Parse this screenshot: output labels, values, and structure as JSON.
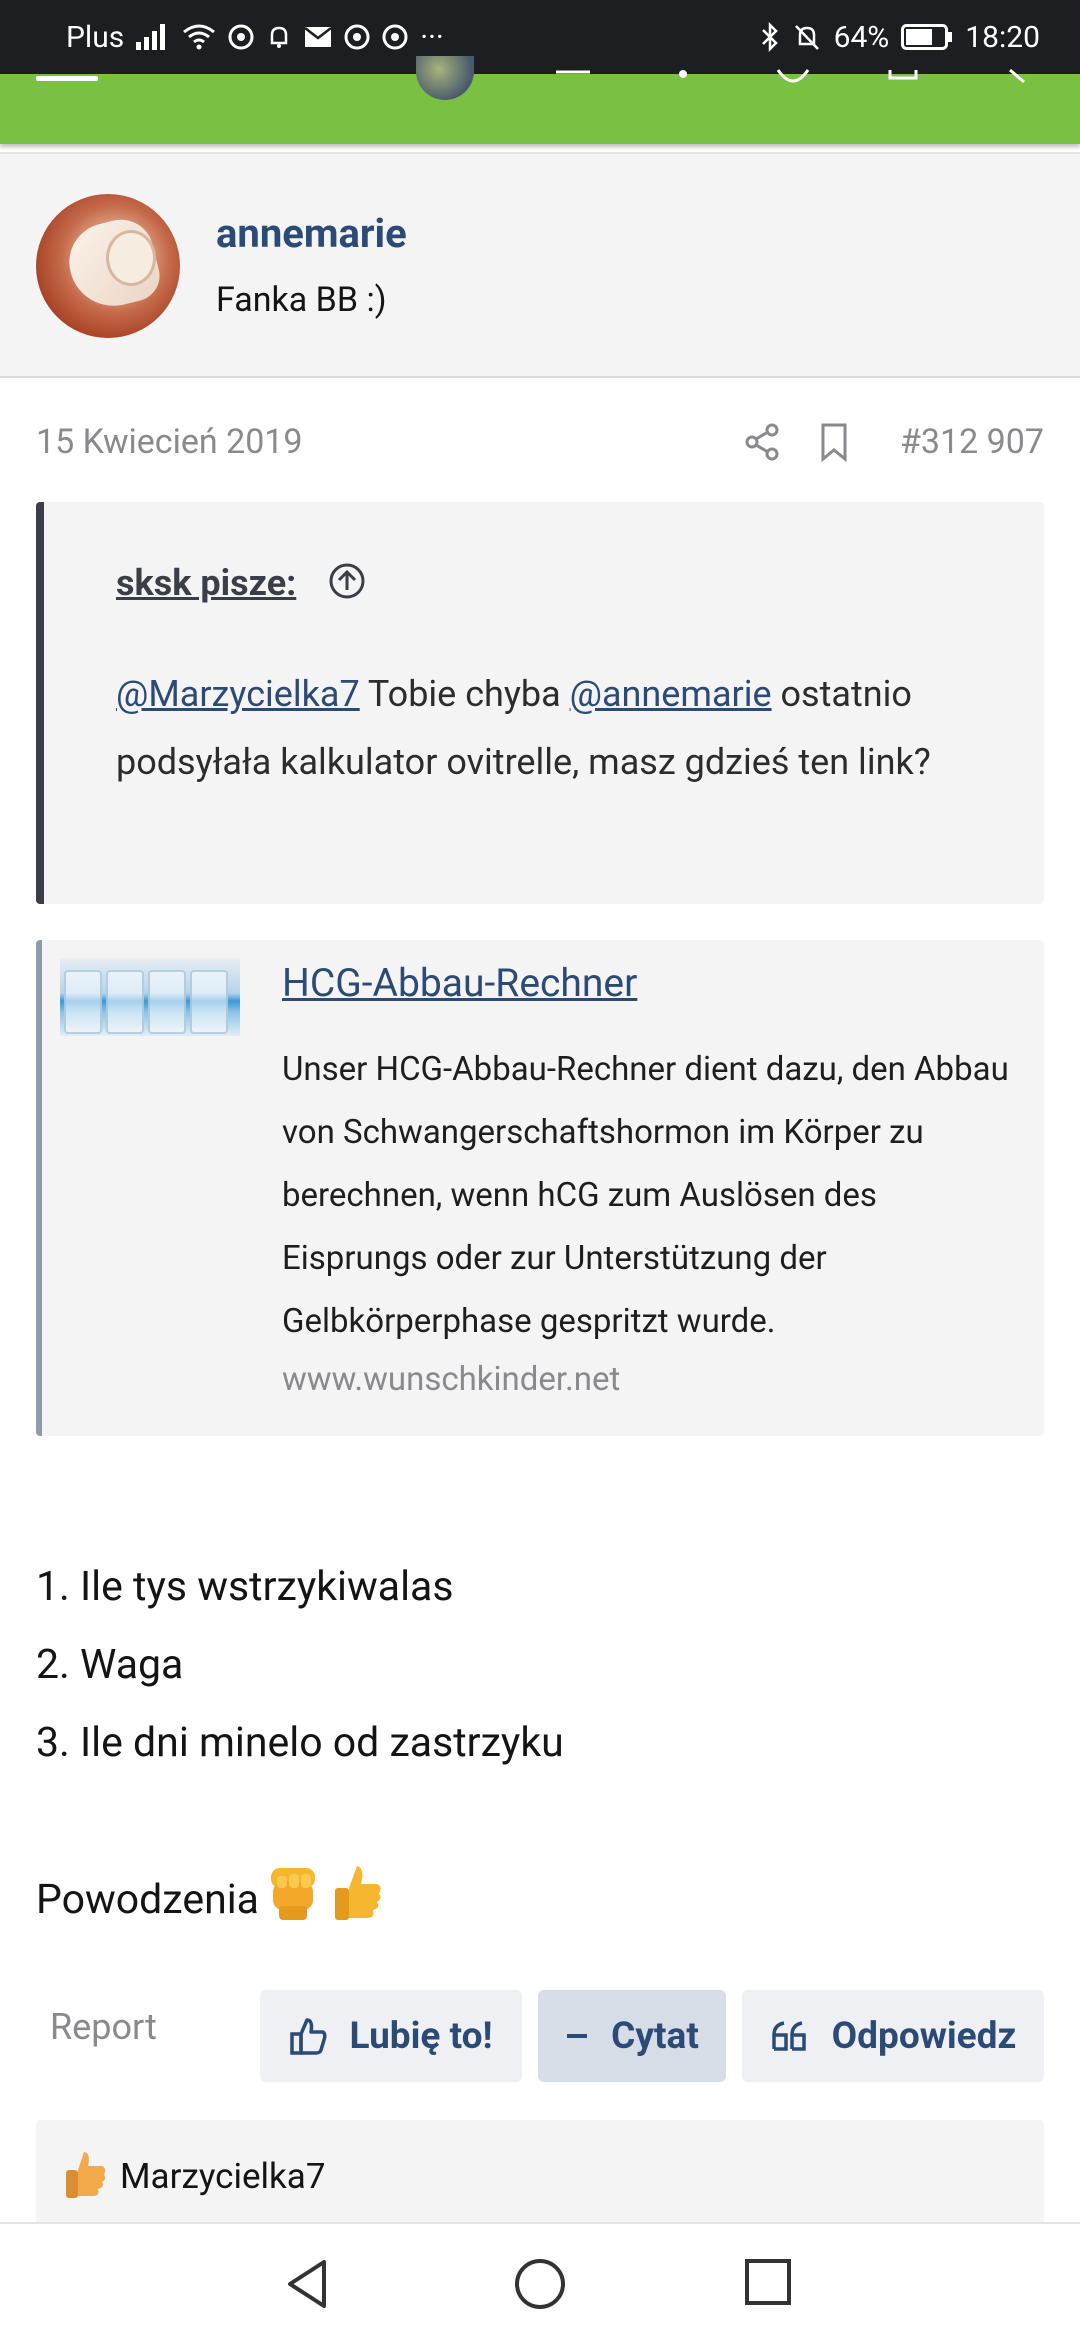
{
  "status_bar": {
    "carrier": "Plus",
    "battery": "64%",
    "time": "18:20",
    "more": "···"
  },
  "author": {
    "name": "annemarie",
    "title": "Fanka BB :)"
  },
  "post": {
    "date": "15 Kwiecień 2019",
    "number": "#312 907",
    "quote": {
      "author_label": "sksk pisze:",
      "mention1": "@Marzycielka7",
      "text1": " Tobie chyba ",
      "mention2": "@annemarie",
      "text2": " ostatnio podsyłała kalkulator ovitrelle, masz gdzieś ten link?"
    },
    "link_preview": {
      "title": "HCG-Abbau-Rechner",
      "description": "Unser HCG-Abbau-Rechner dient dazu, den Abbau von Schwangerschaftshormon im Körper zu berechnen, wenn hCG zum Auslösen des Eisprungs oder zur Unterstützung der Gelbkörperphase gespritzt wurde.",
      "url": "www.wunschkinder.net"
    },
    "list": [
      "1. Ile tys wstrzykiwalas",
      "2. Waga",
      "3. Ile dni minelo od zastrzyku"
    ],
    "closing": "Powodzenia"
  },
  "actions": {
    "report": "Report",
    "like": "Lubię to!",
    "quote": "Cytat",
    "reply": "Odpowiedz"
  },
  "reactions": {
    "users": "Marzycielka7"
  }
}
